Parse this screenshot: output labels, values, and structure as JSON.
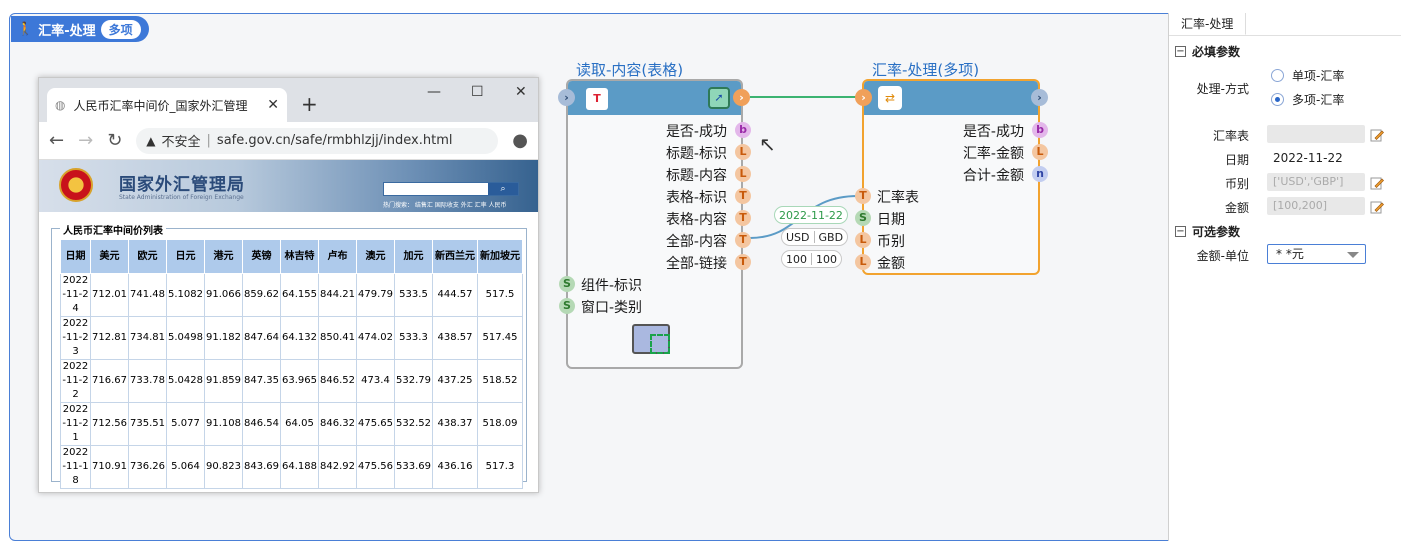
{
  "header": {
    "title": "汇率-处理",
    "badge": "多项"
  },
  "browser": {
    "tab_title": "人民币汇率中间价_国家外汇管理",
    "tab_close": "✕",
    "new_tab": "+",
    "security_label": "不安全",
    "url": "safe.gov.cn/safe/rmbhlzjj/index.html",
    "site_title": "国家外汇管理局",
    "site_subtitle": "State Administration of Foreign Exchange",
    "site_links": "热门搜索： 结售汇 国际收支 外汇 汇率 人民币",
    "table_caption": "人民币汇率中间价列表",
    "table_headers": [
      "日期",
      "美元",
      "欧元",
      "日元",
      "港元",
      "英镑",
      "林吉特",
      "卢布",
      "澳元",
      "加元",
      "新西兰元",
      "新加坡元"
    ],
    "table_rows": [
      [
        "2022-11-24",
        "712.01",
        "741.48",
        "5.1082",
        "91.066",
        "859.62",
        "64.155",
        "844.21",
        "479.79",
        "533.5",
        "444.57",
        "517.5"
      ],
      [
        "2022-11-23",
        "712.81",
        "734.81",
        "5.0498",
        "91.182",
        "847.64",
        "64.132",
        "850.41",
        "474.02",
        "533.3",
        "438.57",
        "517.45"
      ],
      [
        "2022-11-22",
        "716.67",
        "733.78",
        "5.0428",
        "91.859",
        "847.35",
        "63.965",
        "846.52",
        "473.4",
        "532.79",
        "437.25",
        "518.52"
      ],
      [
        "2022-11-21",
        "712.56",
        "735.51",
        "5.077",
        "91.108",
        "846.54",
        "64.05",
        "846.32",
        "475.65",
        "532.52",
        "438.37",
        "518.09"
      ],
      [
        "2022-11-18",
        "710.91",
        "736.26",
        "5.064",
        "90.823",
        "843.69",
        "64.188",
        "842.92",
        "475.56",
        "533.69",
        "436.16",
        "517.3"
      ]
    ]
  },
  "node_read": {
    "title": "读取-内容(表格)",
    "outputs": [
      {
        "label": "是否-成功",
        "type": "b"
      },
      {
        "label": "标题-标识",
        "type": "L"
      },
      {
        "label": "标题-内容",
        "type": "L"
      },
      {
        "label": "表格-标识",
        "type": "T"
      },
      {
        "label": "表格-内容",
        "type": "T"
      },
      {
        "label": "全部-内容",
        "type": "T"
      },
      {
        "label": "全部-链接",
        "type": "T"
      }
    ],
    "inputs": [
      {
        "label": "组件-标识",
        "type": "S"
      },
      {
        "label": "窗口-类别",
        "type": "S"
      }
    ]
  },
  "node_rate": {
    "title": "汇率-处理(多项)",
    "outputs": [
      {
        "label": "是否-成功",
        "type": "b"
      },
      {
        "label": "汇率-金额",
        "type": "L"
      },
      {
        "label": "合计-金额",
        "type": "n"
      }
    ],
    "inputs": [
      {
        "label": "汇率表",
        "type": "T"
      },
      {
        "label": "日期",
        "type": "S"
      },
      {
        "label": "币别",
        "type": "L"
      },
      {
        "label": "金额",
        "type": "L"
      }
    ],
    "chips": {
      "date": "2022-11-22",
      "cur1": "USD",
      "cur2": "GBD",
      "amt1": "100",
      "amt2": "100"
    }
  },
  "panel": {
    "tab": "汇率-处理",
    "required_title": "必填参数",
    "optional_title": "可选参数",
    "collapse_symbol": "−",
    "mode_label": "处理-方式",
    "mode_options": [
      "单项-汇率",
      "多项-汇率"
    ],
    "mode_selected": 1,
    "rate_table_label": "汇率表",
    "date_label": "日期",
    "date_value": "2022-11-22",
    "currency_label": "币别",
    "currency_value": "['USD','GBP']",
    "amount_label": "金额",
    "amount_value": "[100,200]",
    "unit_label": "金额-单位",
    "unit_value": "* *元"
  },
  "colors": {
    "accent": "#3d78d8",
    "node_bar": "#5b9bc6",
    "selected_border": "#f2a32f",
    "link_green": "#3cb371",
    "link_blue": "#5b9bc6"
  }
}
